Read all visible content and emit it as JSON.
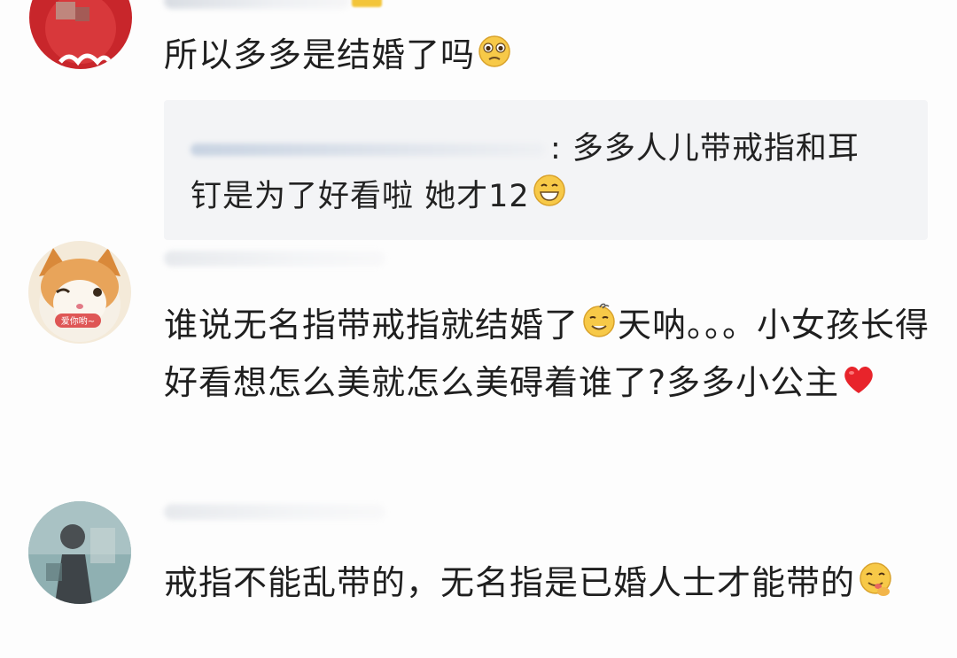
{
  "comments": [
    {
      "text": "所以多多是结婚了吗",
      "emoji": "pleading-face-icon",
      "quote": {
        "text_line1": ": 多多人儿带戒指和耳",
        "text_line2": "钉是为了好看啦 她才12",
        "emoji": "grinning-face-icon"
      }
    },
    {
      "avatar_caption": "爱你哟~",
      "text_part1": "谁说无名指带戒指就结婚了",
      "emoji1": "sweat-smile-face-icon",
      "text_part2": "天呐。。。小女孩长得好看想怎么美就怎么美碍着谁了?多多小公主",
      "emoji2": "red-heart-icon"
    },
    {
      "text": "戒指不能乱带的，无名指是已婚人士才能带的",
      "emoji": "yum-face-icon"
    }
  ],
  "colors": {
    "background": "#fdfdfd",
    "quote_background": "#f3f4f6",
    "text": "#1f1f1f",
    "heart": "#e8242b",
    "emoji_yellow": "#f7c948"
  }
}
